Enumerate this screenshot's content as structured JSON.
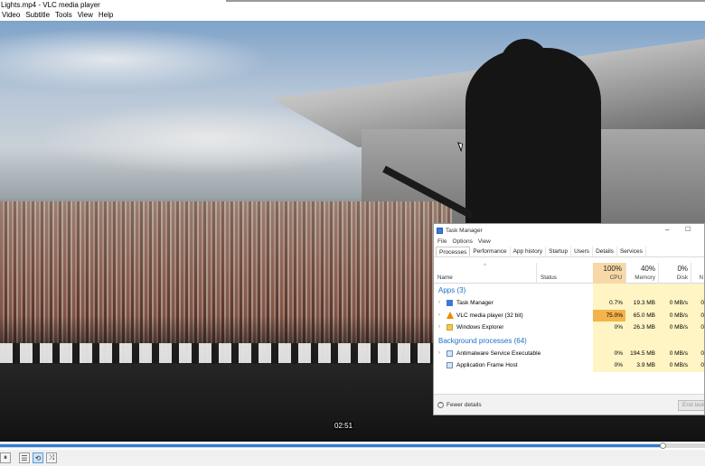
{
  "window": {
    "title": "Lights.mp4 - VLC media player"
  },
  "menu": [
    "Video",
    "Subtitle",
    "Tools",
    "View",
    "Help"
  ],
  "player": {
    "time_overlay": "02:51",
    "progress_fraction": 0.94,
    "controls": [
      {
        "icon": "pause-icon",
        "glyph": "⏸"
      },
      {
        "icon": "playlist-icon",
        "glyph": "☰"
      },
      {
        "icon": "loop-icon",
        "glyph": "⟲"
      },
      {
        "icon": "shuffle-icon",
        "glyph": "⤨"
      }
    ]
  },
  "task_manager": {
    "title": "Task Manager",
    "menu": [
      "File",
      "Options",
      "View"
    ],
    "tabs": [
      "Processes",
      "Performance",
      "App history",
      "Startup",
      "Users",
      "Details",
      "Services"
    ],
    "selected_tab": "Processes",
    "columns": {
      "name": "Name",
      "status": "Status",
      "cpu": {
        "pct": "100%",
        "label": "CPU"
      },
      "memory": {
        "pct": "40%",
        "label": "Memory"
      },
      "disk": {
        "pct": "0%",
        "label": "Disk"
      },
      "network": {
        "label": "N"
      }
    },
    "groups": [
      {
        "label": "Apps (3)",
        "rows": [
          {
            "name": "Task Manager",
            "icon": "task-manager-icon",
            "cpu": "0.7%",
            "memory": "19.3 MB",
            "disk": "0 MB/s",
            "net": "0",
            "expandable": true
          },
          {
            "name": "VLC media player (32 bit)",
            "icon": "vlc-cone-icon",
            "cpu": "75.0%",
            "memory": "65.0 MB",
            "disk": "0 MB/s",
            "net": "0",
            "expandable": true,
            "hot": true
          },
          {
            "name": "Windows Explorer",
            "icon": "folder-icon",
            "cpu": "0%",
            "memory": "26.3 MB",
            "disk": "0 MB/s",
            "net": "0",
            "expandable": true
          }
        ]
      },
      {
        "label": "Background processes (64)",
        "rows": [
          {
            "name": "Antimalware Service Executable",
            "icon": "service-icon",
            "cpu": "0%",
            "memory": "194.5 MB",
            "disk": "0 MB/s",
            "net": "0",
            "expandable": true
          },
          {
            "name": "Application Frame Host",
            "icon": "service-icon",
            "cpu": "0%",
            "memory": "3.9 MB",
            "disk": "0 MB/s",
            "net": "0",
            "expandable": false
          }
        ]
      }
    ],
    "footer": {
      "fewer_details": "Fewer details",
      "end_task": "End task"
    }
  }
}
